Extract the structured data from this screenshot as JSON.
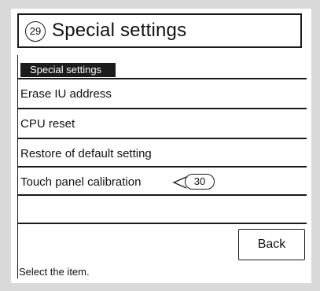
{
  "header": {
    "step_number": "29",
    "title": "Special settings"
  },
  "section": {
    "label": "Special settings"
  },
  "menu": {
    "items": [
      {
        "label": "Erase IU address"
      },
      {
        "label": "CPU reset"
      },
      {
        "label": "Restore of default setting"
      },
      {
        "label": "Touch panel calibration"
      },
      {
        "label": ""
      }
    ]
  },
  "callout": {
    "number": "30"
  },
  "buttons": {
    "back_label": "Back"
  },
  "status": {
    "text": "Select the item."
  }
}
